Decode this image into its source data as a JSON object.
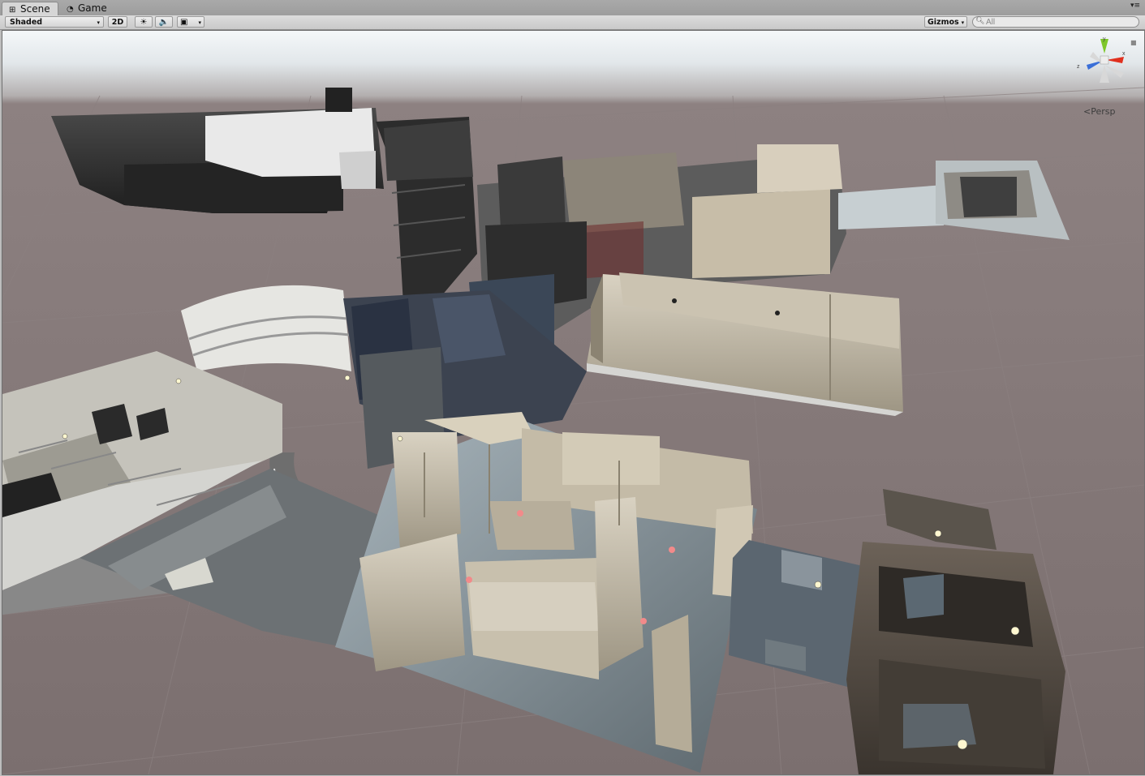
{
  "tabs": [
    {
      "label": "Scene",
      "icon": "scene-grid-icon",
      "active": true
    },
    {
      "label": "Game",
      "icon": "game-pacman-icon",
      "active": false
    }
  ],
  "toolbar": {
    "draw_mode": "Shaded",
    "mode_2d": "2D",
    "lighting_icon": "sun-icon",
    "audio_icon": "speaker-icon",
    "effects_icon": "image-icon",
    "gizmos_label": "Gizmos",
    "search_placeholder": "All"
  },
  "viewport": {
    "projection_label": "Persp",
    "gizmo_axes": [
      "x",
      "y",
      "z"
    ],
    "colors": {
      "sky_top": "#f4f7f9",
      "ground": "#7b6f6f",
      "grid_line": "#8a7f7f",
      "axis_x": "#e0301e",
      "axis_y": "#7ec72a",
      "axis_z": "#3a6fd8"
    }
  }
}
